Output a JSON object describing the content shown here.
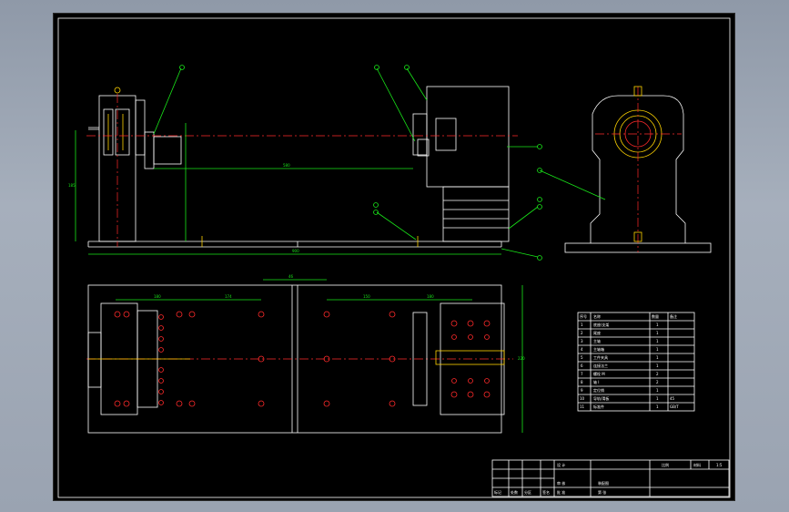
{
  "bom": {
    "headers": [
      "序号",
      "名称",
      "数量",
      "备注"
    ],
    "rows": [
      [
        "1",
        "底座/支架",
        "1",
        ""
      ],
      [
        "2",
        "尾座",
        "1",
        ""
      ],
      [
        "3",
        "主轴",
        "1",
        ""
      ],
      [
        "4",
        "主轴箱",
        "1",
        ""
      ],
      [
        "5",
        "工件夹具",
        "1",
        ""
      ],
      [
        "6",
        "连接法兰",
        "1",
        ""
      ],
      [
        "7",
        "螺栓 M",
        "2",
        ""
      ],
      [
        "8",
        "轴 I",
        "2",
        ""
      ],
      [
        "9",
        "定位销",
        "1",
        ""
      ],
      [
        "10",
        "导轨/滑板",
        "1",
        "45"
      ],
      [
        "11",
        "标准件",
        "1",
        "GB/T"
      ]
    ]
  },
  "title_block": {
    "design": "设 计",
    "check": "审 核",
    "drawing_name": "装配图",
    "scale": "比例",
    "sheet": "第 张",
    "material": "材料",
    "row_labels": [
      "标记",
      "处数",
      "分区",
      "更改文件号",
      "签名",
      "年月日"
    ],
    "approve": "批 准",
    "version": "1:5"
  },
  "colors": {
    "outline": "#ffffff",
    "dimension": "#19e619",
    "centerline": "#ff2a2a",
    "highlight": "#ffd400",
    "background": "#000000"
  }
}
